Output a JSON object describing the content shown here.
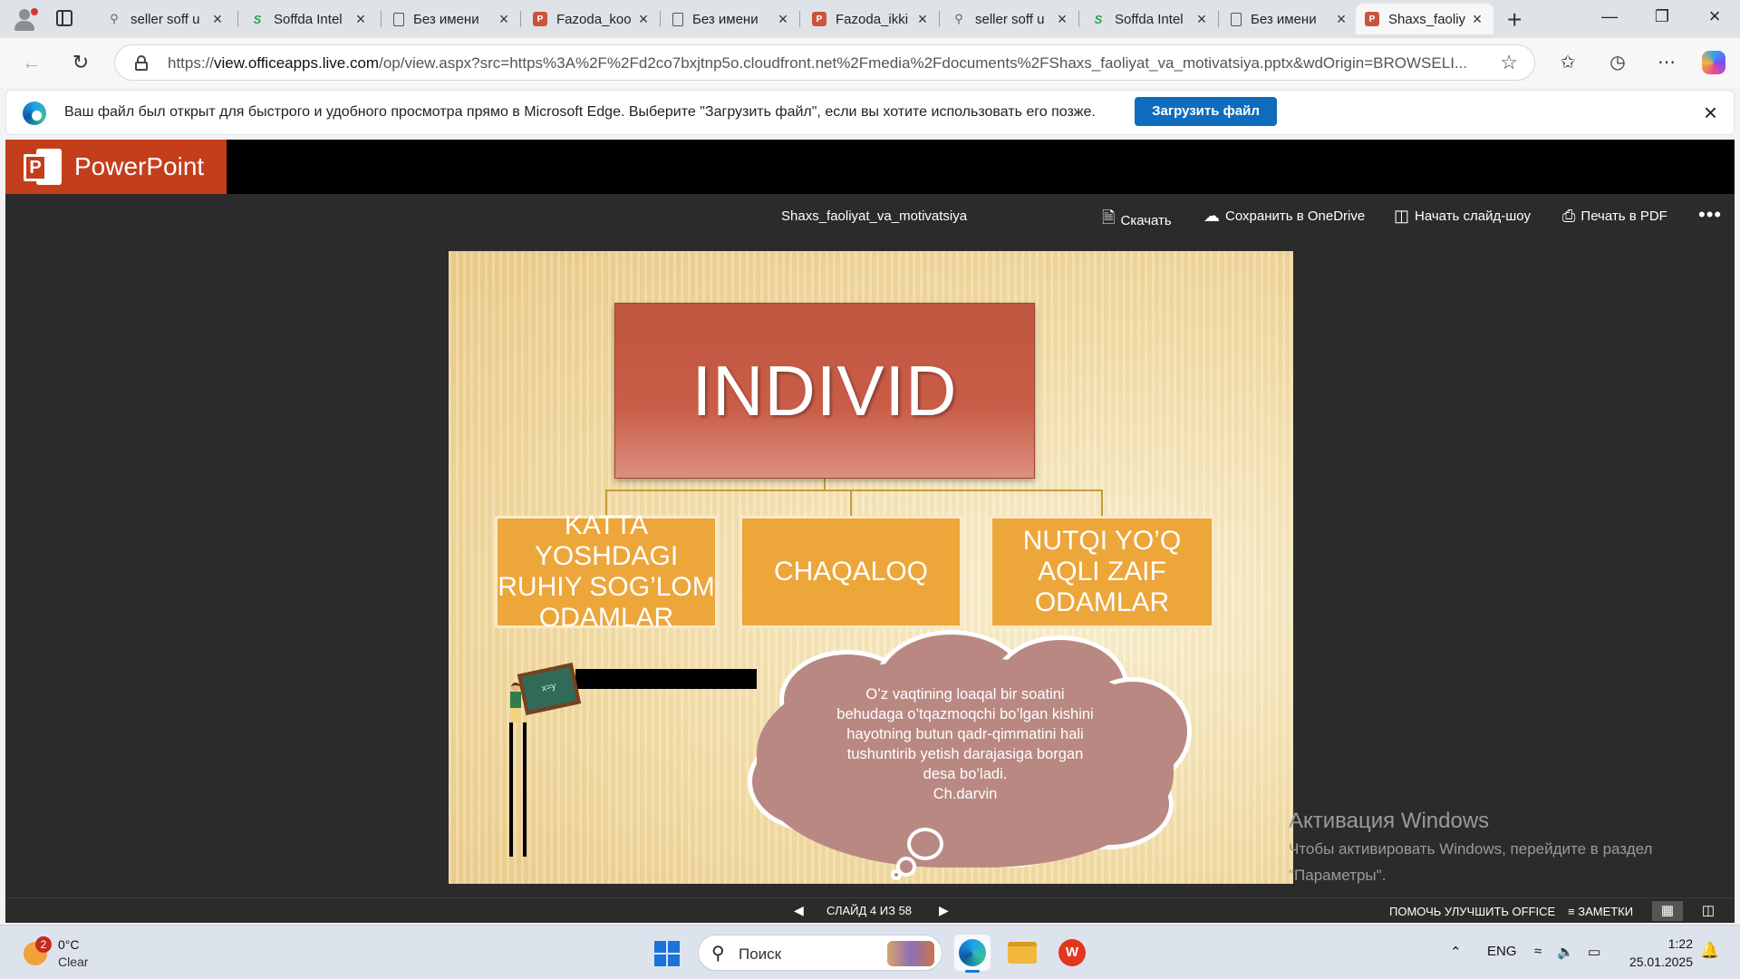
{
  "browser": {
    "tabs": [
      {
        "title": "seller soff u",
        "icon": "search-icon"
      },
      {
        "title": "Soffda Intel",
        "icon": "soffda-icon"
      },
      {
        "title": "Без имени",
        "icon": "document-icon"
      },
      {
        "title": "Fazoda_koo",
        "icon": "powerpoint-icon"
      },
      {
        "title": "Без имени",
        "icon": "document-icon"
      },
      {
        "title": "Fazoda_ikki",
        "icon": "powerpoint-icon"
      },
      {
        "title": "seller soff u",
        "icon": "search-icon"
      },
      {
        "title": "Soffda Intel",
        "icon": "soffda-icon"
      },
      {
        "title": "Без имени",
        "icon": "document-icon"
      },
      {
        "title": "Shaxs_faoliy",
        "icon": "powerpoint-icon",
        "active": true
      }
    ],
    "url_prefix": "https://",
    "url_host": "view.officeapps.live.com",
    "url_rest": "/op/view.aspx?src=https%3A%2F%2Fd2co7bxjtnp5o.cloudfront.net%2Fmedia%2Fdocuments%2FShaxs_faoliyat_va_motivatsiya.pptx&wdOrigin=BROWSELI..."
  },
  "infobar": {
    "message": "Ваш файл был открыт для быстрого и удобного просмотра прямо в Microsoft Edge. Выберите \"Загрузить файл\", если вы хотите использовать его позже.",
    "download_label": "Загрузить файл"
  },
  "office": {
    "app_name": "PowerPoint",
    "document_name": "Shaxs_faoliyat_va_motivatsiya",
    "commands": {
      "download": "Скачать",
      "save_onedrive": "Сохранить в OneDrive",
      "slideshow": "Начать слайд-шоу",
      "print_pdf": "Печать в PDF"
    },
    "status": {
      "slide_counter": "СЛАЙД 4 ИЗ 58",
      "help_improve": "ПОМОЧЬ УЛУЧШИТЬ OFFICE",
      "notes": "ЗАМЕТКИ"
    }
  },
  "slide": {
    "main_box": "INDIVID",
    "sub_boxes": [
      "KATTA YOSHDAGI RUHIY SOG’LOM ODAMLAR",
      "CHAQALOQ",
      "NUTQI YO’Q AQLI ZAIF ODAMLAR"
    ],
    "quote_lines": [
      "O’z vaqtining loaqal bir soatini",
      "behudaga o’tqazmoqchi bo’lgan kishini",
      "hayotning butun qadr-qimmatini hali",
      "tushuntirib yetish darajasiga borgan",
      "desa bo’ladi.",
      "Ch.darvin"
    ]
  },
  "watermark": {
    "title": "Активация Windows",
    "line1": "Чтобы активировать Windows, перейдите в раздел",
    "line2": "\"Параметры\"."
  },
  "taskbar": {
    "weather_badge": "2",
    "temperature": "0°C",
    "condition": "Clear",
    "search_placeholder": "Поиск",
    "language": "ENG",
    "time": "1:22",
    "date": "25.01.2025"
  },
  "colors": {
    "powerpoint_brand": "#c43e1c",
    "download_button": "#0f6cbd",
    "main_box": "#c95d48",
    "sub_box": "#eda63a",
    "cloud": "#b98882"
  }
}
